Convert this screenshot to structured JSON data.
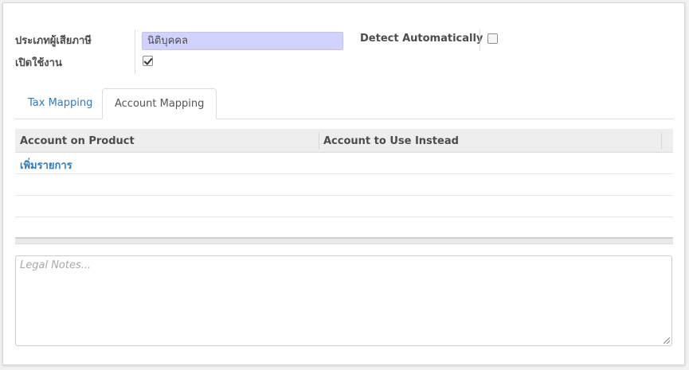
{
  "form": {
    "taxpayer_type_label": "ประเภทผู้เสียภาษี",
    "taxpayer_type_value": "นิติบุคคล",
    "active_label": "เปิดใช้งาน",
    "active_checked": true,
    "detect_auto_label": "Detect Automatically",
    "detect_auto_checked": false
  },
  "tabs": [
    {
      "label": "Tax Mapping",
      "active": false
    },
    {
      "label": "Account Mapping",
      "active": true
    }
  ],
  "table": {
    "columns": [
      "Account on Product",
      "Account to Use Instead"
    ],
    "add_item_label": "เพิ่มรายการ",
    "empty_rows": 3
  },
  "notes": {
    "placeholder": "Legal Notes..."
  },
  "colors": {
    "link": "#337ab7",
    "required_field_bg": "#d2d2ff",
    "header_bg": "#eeeeee"
  }
}
